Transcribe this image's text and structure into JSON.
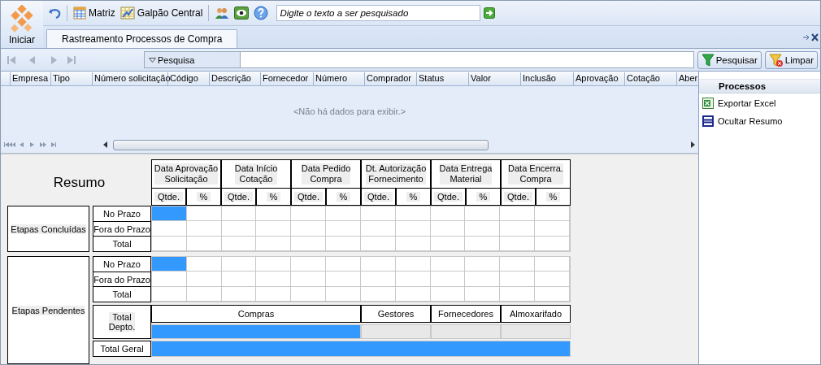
{
  "start_button": {
    "label": "Iniciar"
  },
  "toolbar": {
    "items": [
      {
        "kind": "icon"
      },
      {
        "kind": "separator"
      },
      {
        "kind": "labeled",
        "label": "Matriz"
      },
      {
        "kind": "labeled",
        "label": "Galpão Central"
      },
      {
        "kind": "separator"
      },
      {
        "kind": "icon"
      },
      {
        "kind": "icon"
      },
      {
        "kind": "icon"
      }
    ],
    "search": {
      "placeholder": "Digite o texto a ser pesquisado"
    }
  },
  "tabs": [
    {
      "label": "Rastreamento Processos de Compra",
      "selected": true
    }
  ],
  "filter": {
    "label": "Pesquisa"
  },
  "buttons": [
    {
      "kind": "search",
      "label": "Pesquisar"
    },
    {
      "kind": "clear",
      "label": "Limpar"
    }
  ],
  "grid": {
    "columns": [
      "Empresa",
      "Tipo",
      "Número solicitação",
      "Código",
      "Descrição",
      "Fornecedor",
      "Número",
      "Comprador",
      "Status",
      "Valor",
      "Inclusão",
      "Aprovação",
      "Cotação",
      "Aber"
    ],
    "empty_text": "<Não há dados para exibir.>"
  },
  "side_panel": {
    "title": "Processos",
    "items": [
      {
        "kind": "excel",
        "label": "Exportar Excel"
      },
      {
        "kind": "hide",
        "label": "Ocultar Resumo"
      }
    ]
  },
  "summary": {
    "title": "Resumo",
    "columns": [
      {
        "label": "Data Aprovação\nSolicitação",
        "sub": [
          "Qtde.",
          "%"
        ]
      },
      {
        "label": "Data Início\nCotação",
        "sub": [
          "Qtde.",
          "%"
        ]
      },
      {
        "label": "Data Pedido\nCompra",
        "sub": [
          "Qtde.",
          "%"
        ]
      },
      {
        "label": "Dt. Autorização\nFornecimento",
        "sub": [
          "Qtde.",
          "%"
        ]
      },
      {
        "label": "Data Entrega\nMaterial",
        "sub": [
          "Qtde.",
          "%"
        ]
      },
      {
        "label": "Data Encerra.\nCompra",
        "sub": [
          "Qtde.",
          "%"
        ]
      }
    ],
    "groups": [
      {
        "label": "Etapas Concluídas",
        "rows": [
          {
            "label": "No Prazo",
            "highlighted": [
              true,
              false,
              false,
              false,
              false,
              false,
              false,
              false,
              false,
              false,
              false,
              false
            ]
          },
          {
            "label": "Fora do Prazo",
            "highlighted": [
              false,
              false,
              false,
              false,
              false,
              false,
              false,
              false,
              false,
              false,
              false,
              false
            ]
          },
          {
            "label": "Total",
            "highlighted": [
              false,
              false,
              false,
              false,
              false,
              false,
              false,
              false,
              false,
              false,
              false,
              false
            ]
          }
        ]
      },
      {
        "label": "Etapas Pendentes",
        "rows": [
          {
            "label": "No Prazo",
            "highlighted": [
              true,
              false,
              false,
              false,
              false,
              false,
              false,
              false,
              false,
              false,
              false,
              false
            ]
          },
          {
            "label": "Fora do Prazo",
            "highlighted": [
              false,
              false,
              false,
              false,
              false,
              false,
              false,
              false,
              false,
              false,
              false,
              false
            ]
          },
          {
            "label": "Total",
            "highlighted": [
              false,
              false,
              false,
              false,
              false,
              false,
              false,
              false,
              false,
              false,
              false,
              false
            ]
          }
        ],
        "departments": {
          "label": "Total\nDepto.",
          "items": [
            {
              "name": "Compras",
              "level": 1
            },
            {
              "name": "Gestores",
              "level": 0
            },
            {
              "name": "Fornecedores",
              "level": 0
            },
            {
              "name": "Almoxarifado",
              "level": 0
            }
          ]
        },
        "total": {
          "label": "Total Geral",
          "level": 1
        }
      }
    ]
  }
}
